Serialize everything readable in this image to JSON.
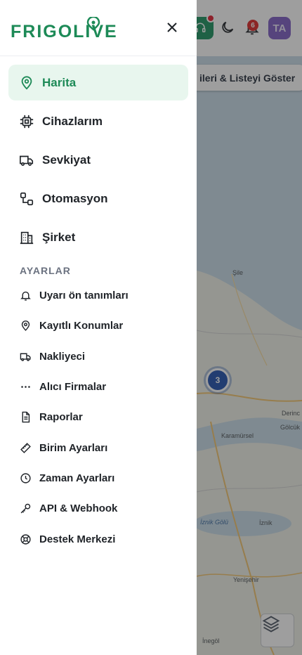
{
  "app": {
    "logo_text": "FRIGOLIVE"
  },
  "colors": {
    "brand": "#1d8a57",
    "active_bg": "#e8f6ee",
    "text": "#1f2328",
    "muted": "#6b7280"
  },
  "nav": {
    "main": [
      {
        "label": "Harita",
        "icon": "map-pin-icon",
        "active": true
      },
      {
        "label": "Cihazlarım",
        "icon": "chip-icon",
        "active": false
      },
      {
        "label": "Sevkiyat",
        "icon": "truck-icon",
        "active": false
      },
      {
        "label": "Otomasyon",
        "icon": "workflow-icon",
        "active": false
      },
      {
        "label": "Şirket",
        "icon": "building-icon",
        "active": false
      }
    ],
    "section_title": "AYARLAR",
    "settings": [
      {
        "label": "Uyarı ön tanımları",
        "icon": "bell-icon"
      },
      {
        "label": "Kayıtlı Konumlar",
        "icon": "map-pin-icon"
      },
      {
        "label": "Nakliyeci",
        "icon": "truck-icon"
      },
      {
        "label": "Alıcı Firmalar",
        "icon": "more-horizontal-icon"
      },
      {
        "label": "Raporlar",
        "icon": "file-text-icon"
      },
      {
        "label": "Birim Ayarları",
        "icon": "ruler-icon"
      },
      {
        "label": "Zaman Ayarları",
        "icon": "clock-icon"
      },
      {
        "label": "API & Webhook",
        "icon": "key-icon"
      },
      {
        "label": "Destek Merkezi",
        "icon": "lifebuoy-icon"
      }
    ]
  },
  "background": {
    "list_button_label": "ileri & Listeyi Göster",
    "notification_count": "6",
    "avatar_initials": "TA",
    "cluster_count": "3",
    "map_labels": [
      "Şile",
      "Derinc",
      "Gölcük",
      "Karamürsel",
      "İznik Gölü",
      "İznik",
      "Yenişehir",
      "İnegöl"
    ]
  }
}
